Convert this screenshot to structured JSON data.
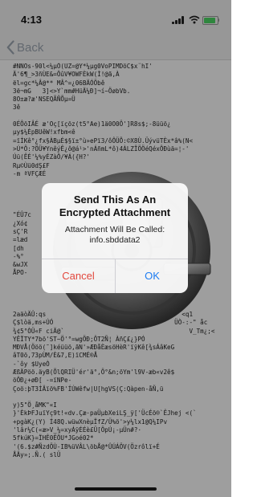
{
  "status_bar": {
    "time": "4:13",
    "battery_color": "#4cd964"
  },
  "nav": {
    "back_label": "Back",
    "back_icon": "chevron-left-icon"
  },
  "file_content": {
    "lines": [
      "#NNOs-90l<¼µÓ(UZ=@Y*¼µg0VoPIMDöC$x¨hI'",
      "Ä'6¶_>3ñÙE&=ÔûV¥OWFÈkW(Ì!@ã,À",
      "ël=gc*¼Â@** MÂ^=¿06BÄÓÖbê",
      "3ë¬mG   3]<>Y`mm#HüÄ¼Ð]¬í~ÖøbVb.",
      "8O±æ?æ'NSEQÃÑÕµ=Ü",
      "3ê",
      "",
      "0ÉÔöIÂÉ æ'Oç[ïçõz(t5°Ae)1ä0O0Ö']R8s$;-8üüö¿",
      "µy$¼ÈpBUêW!xfbm<ê",
      "=ïÍKê°¿fx§ÀBµÉ$§ï±°ù»ePï3/ôÔÜÕ:©X8Ù.ÜývüTÈx*â%(N<",
      ">Ú*Ö:?ÖÜ¥YnêýÊ¿ô@á¹>'nÁñmL*ô)4ÀLZÎÖÖéQéxÔÐùä=¦-'",
      "Úü(ÊÉ'¼%yÉZàÔ/¥Á({H?'",
      "Rµ©Ùü0dŞ£F",
      "-m ªVFÇÆÉ",
      "",
      "",
      "",
      "",
      "\"ÉÛ7c",
      "¿Xó¢",
      "sÇ'R",
      "=læd",
      "[dh",
      "-%°",
      "&wJX",
      "ÅPO-",
      "",
      "",
      "",
      "",
      "2aäòÄÛ:qs                                     <q1",
      "Ç$lòä,ms+ÚÓ                                 ÜÒ-:-\" åc",
      "¾¢5°ÒÜ«F ciÄ@`                                  V_Tm¿;<",
      "YÊÏTY*7bõ'ST~Ö'°=wgÖÐ;ÔT2Ñ¦ ÀñÇ£¿}PÓ",
      "MÐVÅ(Ööö(˜]kéüüö,ãN'»ÆÐåÈæsöHèR'ïÿKê[¾sÁâKeG",
      "âT0ö,73pÙM/È&7,E)ïCMÉ®Å",
      "-`ôy $UyeÒ",
      "ÆßÄPöö.äyB(ÕlQRIÜ'ér'ä°,Ö°&n;öYm'l9V-æb«v2ê$",
      "öÔÐ¿+øÐ[ -=ïNPe-",
      "Çoö:þT3ÍÄïö%FB'ÍÚWêfw|U[hgVS(Ç:Qàpen-åÑ,ü",
      "",
      "y)5\"Ö¸åMK\"«I",
      "}'ÈkÞFJuïYç9t!«dv.Çæ·paÜµbXeiLŞ_ÿ['ÜcÉö®`ÊJhej <(`",
      "+pgàK¿(Y) Í48Q.wüwXnèµÏfZ/Ü%ö'>y¼lx1@Q¼IPv",
      "'lâr¼C(«æ>V_¼=xyÁÿÉÉè£Ü[ÖpÚ¡-µÜn#?·",
      "5fkúK}=ÏHÊ0ÊÖU*JGoé02*",
      "'(6.$z#ÑzdÖÙ-IB%üVÂL\\öbÅ@*ÛÚÁÖV(Özrôlï+É",
      "ÅÄy»;.Ñ.( slÜ"
    ]
  },
  "alert": {
    "title": "Send This As An Encrypted Attachment",
    "message": "Attachment Will Be Called: info.sbddata2",
    "cancel_label": "Cancel",
    "ok_label": "OK",
    "cancel_color": "#e2483d",
    "ok_color": "#1d7cf2"
  }
}
